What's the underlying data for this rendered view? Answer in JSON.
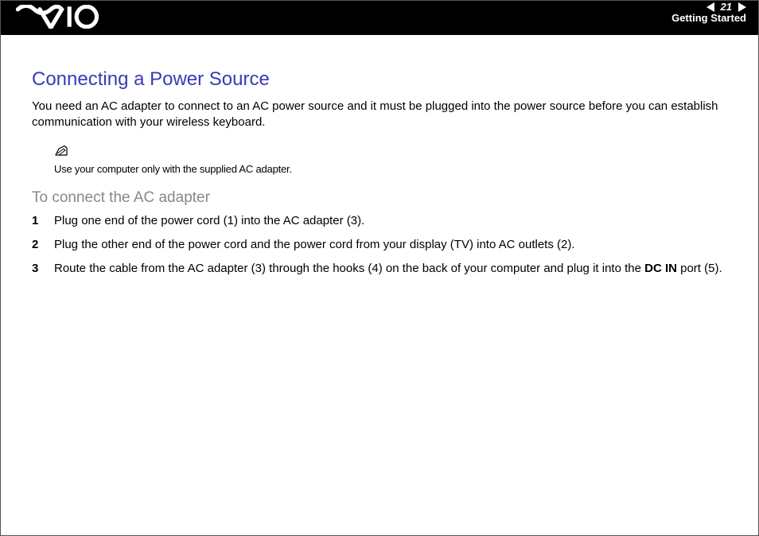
{
  "header": {
    "page_number": "21",
    "section": "Getting Started"
  },
  "content": {
    "heading": "Connecting a Power Source",
    "intro": "You need an AC adapter to connect to an AC power source and it must be plugged into the power source before you can establish communication with your wireless keyboard.",
    "note": "Use your computer only with the supplied AC adapter.",
    "subheading": "To connect the AC adapter",
    "steps": {
      "s1": "Plug one end of the power cord (1) into the AC adapter (3).",
      "s2": "Plug the other end of the power cord and the power cord from your display (TV) into AC outlets (2).",
      "s3_a": "Route the cable from the AC adapter (3) through the hooks (4) on the back of your computer and plug it into the ",
      "s3_b": "DC IN",
      "s3_c": " port (5)."
    }
  }
}
